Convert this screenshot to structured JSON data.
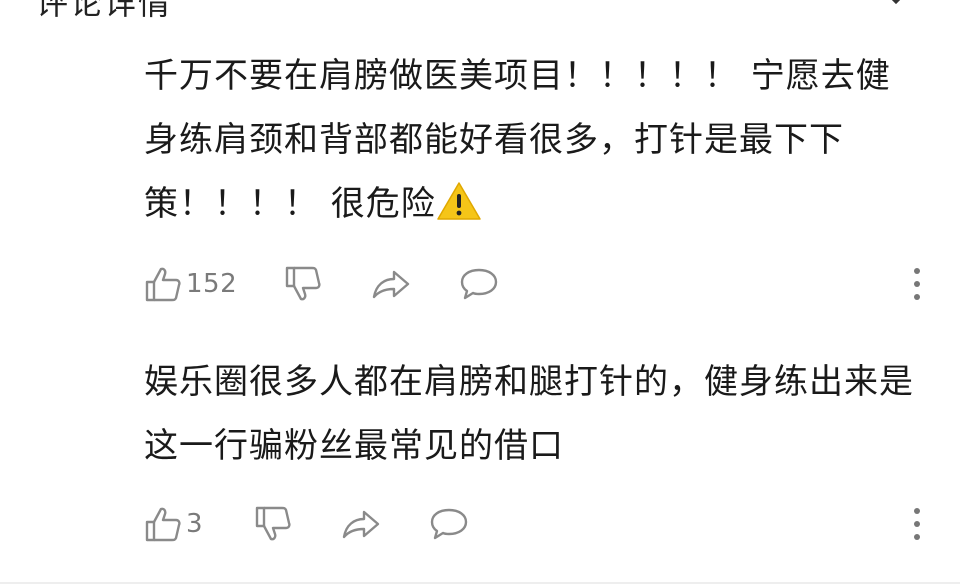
{
  "header": {
    "cut_text": "评论详情",
    "close_icon": "close-icon"
  },
  "comments": [
    {
      "text": "千万不要在肩膀做医美项目！！！！！ 宁愿去健身练肩颈和背部都能好看很多，打针是最下下策！！！！ 很危险",
      "emoji": "warning-icon",
      "likes": "152"
    },
    {
      "text": "娱乐圈很多人都在肩膀和腿打针的，健身练出来是这一行骗粉丝最常见的借口",
      "likes": "3"
    }
  ],
  "icons": {
    "like": "thumbs-up-icon",
    "dislike": "thumbs-down-icon",
    "share": "share-icon",
    "reply": "reply-icon",
    "more": "more-vertical-icon"
  },
  "colors": {
    "text": "#1a1a1a",
    "icon": "#8a8a8a",
    "warning": "#f5c518"
  }
}
